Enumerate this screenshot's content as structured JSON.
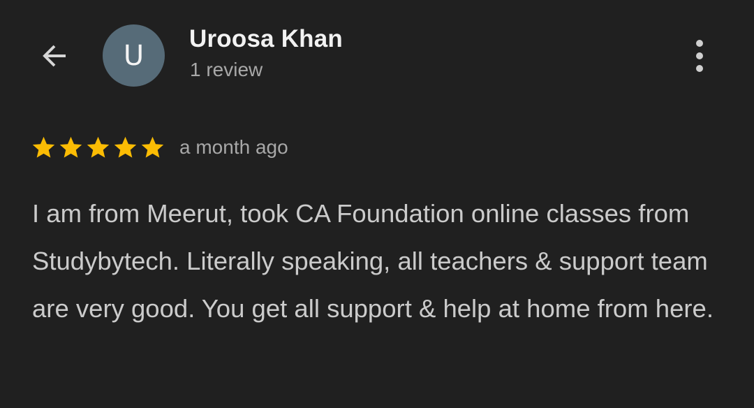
{
  "header": {
    "back_icon": "arrow-back-icon",
    "avatar_initial": "U",
    "user_name": "Uroosa Khan",
    "review_count": "1 review",
    "more_icon": "more-vert-icon"
  },
  "review": {
    "rating": 5,
    "rating_max": 5,
    "star_color": "#fbbc04",
    "time": "a month ago",
    "text": "I am from Meerut, took CA Foundation online classes from Studybytech. Literally speaking, all teachers & support team are very good. You get all support & help at home from here."
  },
  "colors": {
    "background": "#202020",
    "avatar_bg": "#566b78"
  }
}
